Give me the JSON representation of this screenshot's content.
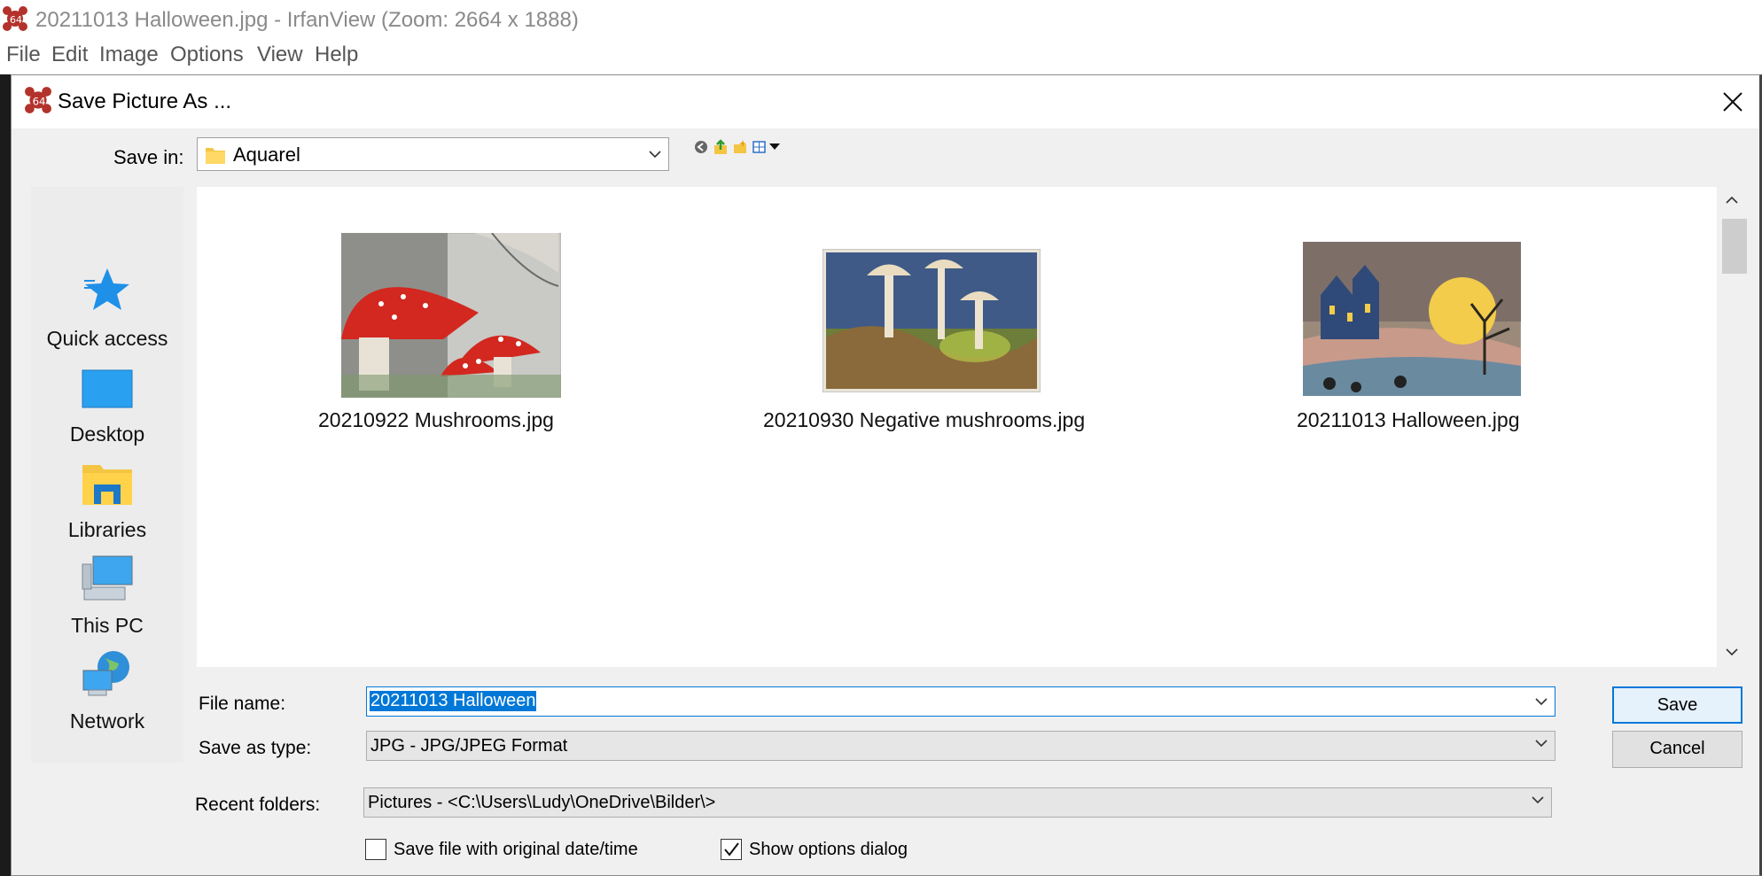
{
  "app": {
    "title": "20211013 Halloween.jpg - IrfanView (Zoom: 2664 x 1888)",
    "icon": "irfanview-cat-icon",
    "menu": [
      "File",
      "Edit",
      "Image",
      "Options",
      "View",
      "Help"
    ]
  },
  "dialog": {
    "title": "Save Picture As ...",
    "save_in": {
      "label": "Save in:",
      "value": "Aquarel",
      "icon": "folder-icon"
    },
    "toolbar_icons": [
      "back-icon",
      "up-folder-icon",
      "new-folder-icon",
      "view-menu-icon"
    ],
    "places": [
      {
        "label": "Quick access",
        "icon": "quick-access-star-icon"
      },
      {
        "label": "Desktop",
        "icon": "desktop-icon"
      },
      {
        "label": "Libraries",
        "icon": "libraries-icon"
      },
      {
        "label": "This PC",
        "icon": "computer-icon"
      },
      {
        "label": "Network",
        "icon": "network-icon"
      }
    ],
    "files": [
      {
        "name": "20210922 Mushrooms.jpg"
      },
      {
        "name": "20210930 Negative mushrooms.jpg"
      },
      {
        "name": "20211013 Halloween.jpg"
      }
    ],
    "file_name": {
      "label": "File name:",
      "value": "20211013 Halloween"
    },
    "save_as_type": {
      "label": "Save as type:",
      "value": "JPG - JPG/JPEG Format"
    },
    "recent_folders": {
      "label": "Recent folders:",
      "value": "Pictures  -  <C:\\Users\\Ludy\\OneDrive\\Bilder\\>"
    },
    "buttons": {
      "save": "Save",
      "cancel": "Cancel"
    },
    "options": {
      "original_date": {
        "label": "Save file with original date/time",
        "checked": false
      },
      "show_options": {
        "label": "Show options dialog",
        "checked": true
      }
    },
    "colors": {
      "accent": "#0078d7",
      "selection": "#0078d7"
    }
  }
}
